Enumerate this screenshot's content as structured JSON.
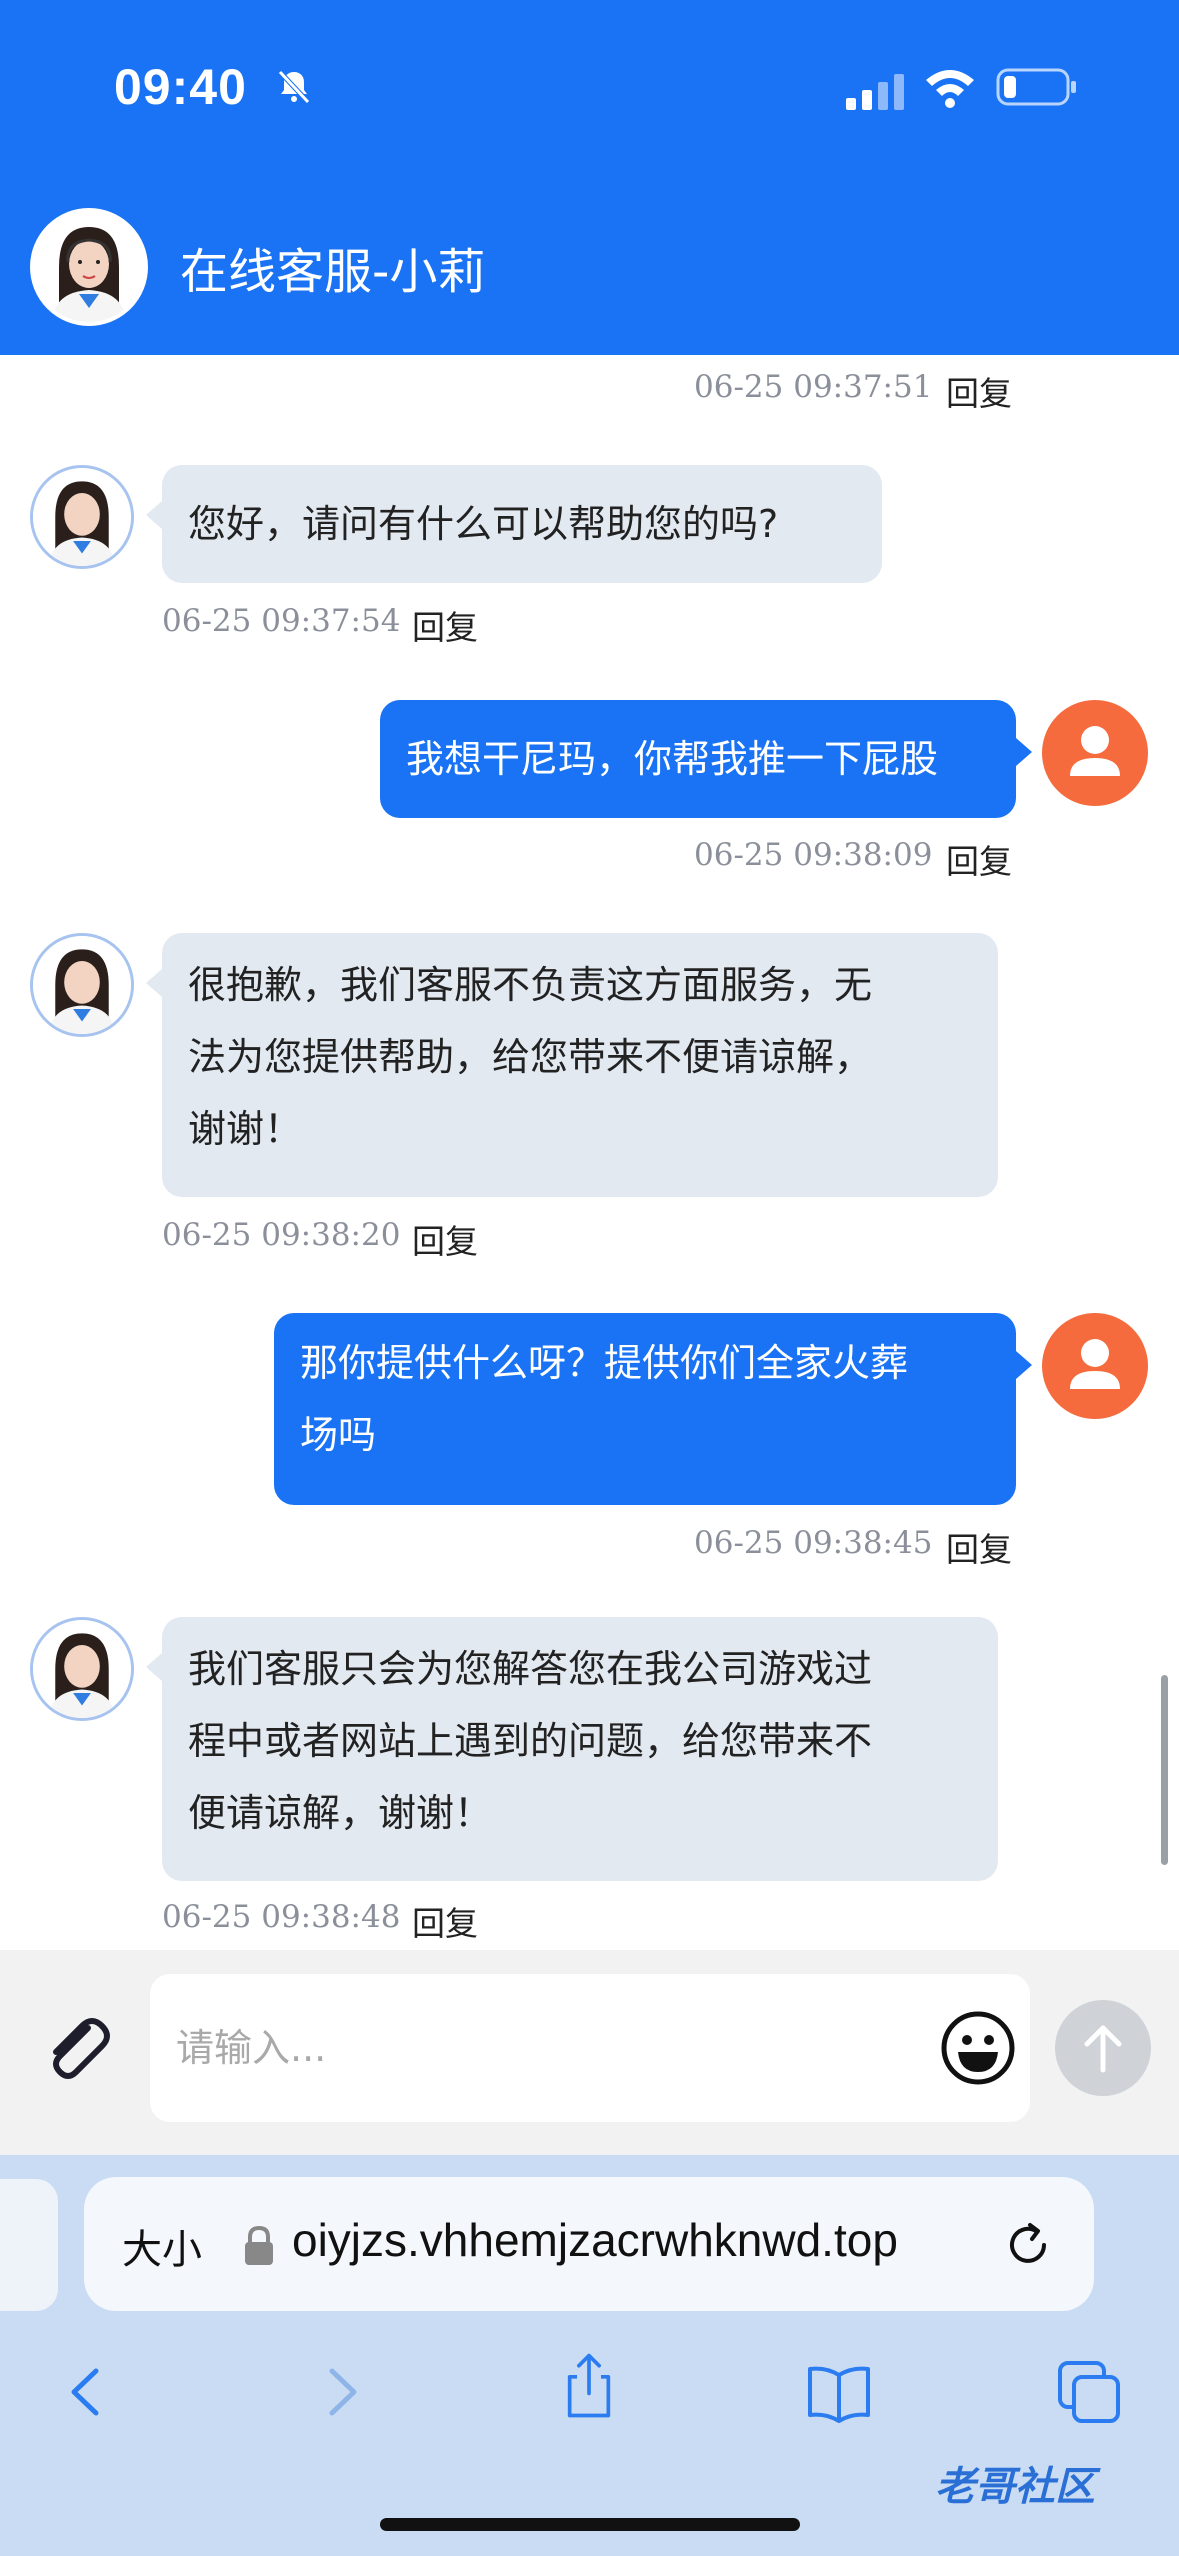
{
  "status_bar": {
    "time": "09:40"
  },
  "header": {
    "title": "在线客服-小莉"
  },
  "messages": [
    {
      "from": "user",
      "time": "06-25 09:37:51",
      "reply": "回复"
    },
    {
      "from": "agent",
      "text": "您好，请问有什么可以帮助您的吗?",
      "time": "06-25 09:37:54",
      "reply": "回复"
    },
    {
      "from": "user",
      "text": "我想干尼玛，你帮我推一下屁股",
      "time": "06-25 09:38:09",
      "reply": "回复"
    },
    {
      "from": "agent",
      "text": "很抱歉，我们客服不负责这方面服务，无\n法为您提供帮助，给您带来不便请谅解，\n谢谢！",
      "time": "06-25 09:38:20",
      "reply": "回复"
    },
    {
      "from": "user",
      "text": "那你提供什么呀？提供你们全家火葬\n场吗",
      "time": "06-25 09:38:45",
      "reply": "回复"
    },
    {
      "from": "agent",
      "text": "我们客服只会为您解答您在我公司游戏过\n程中或者网站上遇到的问题，给您带来不\n便请谅解，谢谢！",
      "time": "06-25 09:38:48",
      "reply": "回复"
    }
  ],
  "input": {
    "placeholder": "请输入..."
  },
  "browser": {
    "text_size_label": "大小",
    "url": "oiyjzs.vhhemjzacrwhknwd.top"
  },
  "watermark": "老哥社区",
  "colors": {
    "accent": "#1a73f5",
    "agent_bubble": "#e3e9f1",
    "user_avatar": "#f56b3d"
  }
}
